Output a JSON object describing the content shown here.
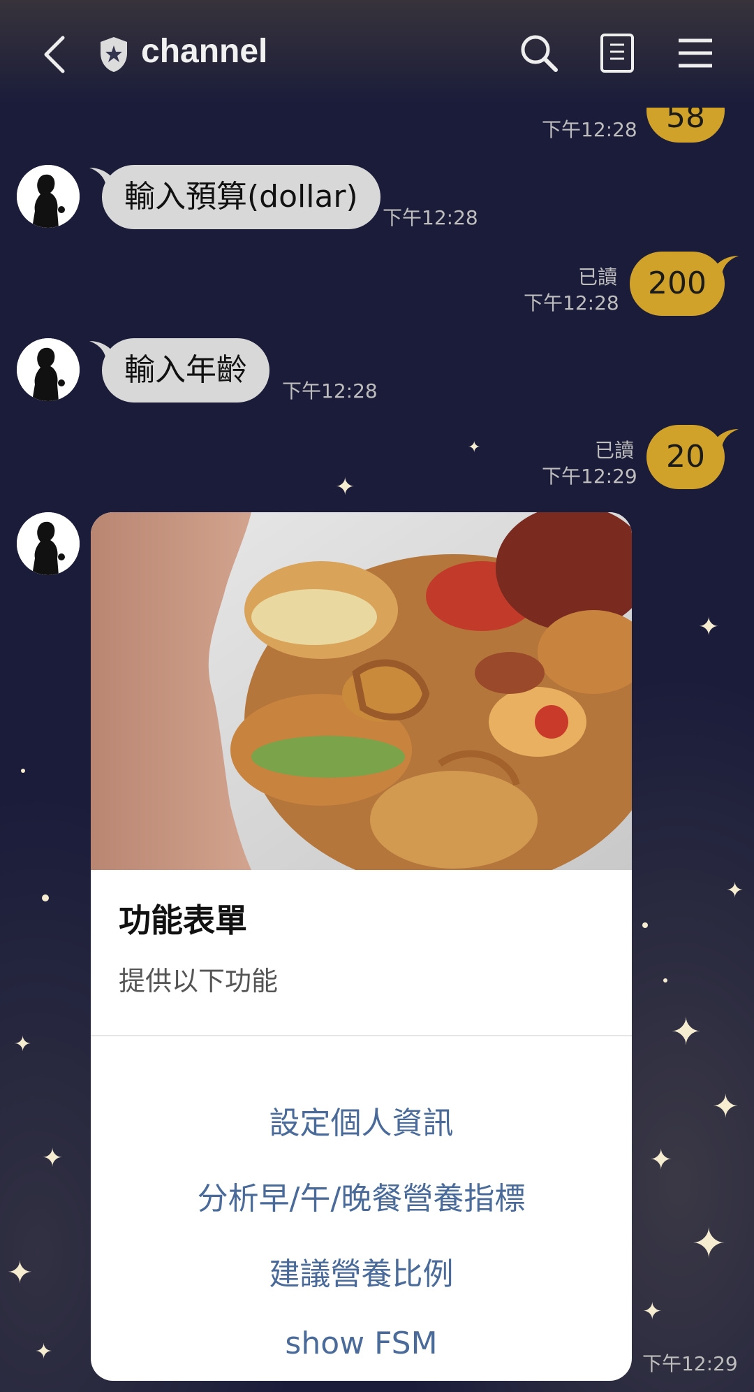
{
  "header": {
    "title": "channel"
  },
  "messages": {
    "prev_out": {
      "value": "58",
      "time": "下午12:28"
    },
    "msg1": {
      "text": "輸入預算(dollar)",
      "time": "下午12:28"
    },
    "reply1": {
      "read": "已讀",
      "time": "下午12:28",
      "text": "200"
    },
    "msg2": {
      "text": "輸入年齡",
      "time": "下午12:28"
    },
    "reply2": {
      "read": "已讀",
      "time": "下午12:29",
      "text": "20"
    }
  },
  "card": {
    "title": "功能表單",
    "subtitle": "提供以下功能",
    "actions": [
      "設定個人資訊",
      "分析早/午/晚餐營養指標",
      "建議營養比例",
      "show FSM"
    ],
    "time": "下午12:29"
  },
  "colors": {
    "background": "#1a1c3a",
    "outgoing_bubble": "#d1a22a",
    "incoming_bubble": "#d8d8d8",
    "action_text": "#4a6b99"
  }
}
